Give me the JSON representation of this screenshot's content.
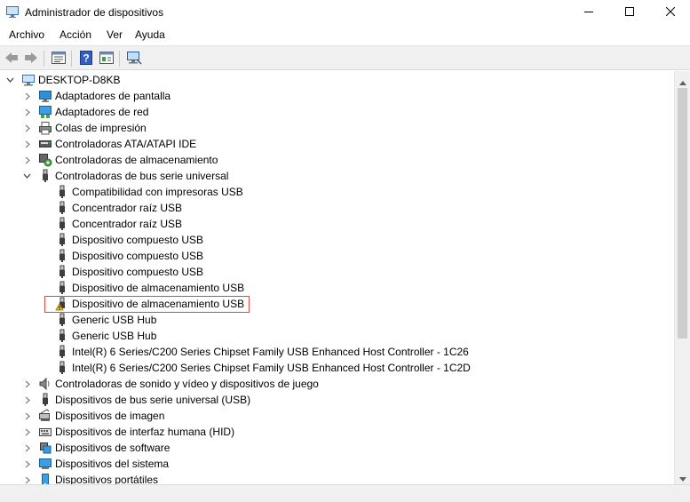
{
  "window": {
    "title": "Administrador de dispositivos",
    "icons": {
      "app": "device-manager-icon",
      "minimize": "minimize-icon",
      "maximize": "maximize-icon",
      "close": "close-icon"
    }
  },
  "menu": [
    "Archivo",
    "Acción",
    "Ver",
    "Ayuda"
  ],
  "toolbar": {
    "buttons": [
      "back-icon",
      "forward-icon",
      "properties-icon",
      "help-icon",
      "update-driver-icon",
      "monitor-scan-icon"
    ]
  },
  "tree": {
    "root": "DESKTOP-D8KB",
    "categories_before": [
      "Adaptadores de pantalla",
      "Adaptadores de red",
      "Colas de impresión",
      "Controladoras ATA/ATAPI IDE",
      "Controladoras de almacenamiento"
    ],
    "expanded": {
      "label": "Controladoras de bus serie universal",
      "children": [
        "Compatibilidad con impresoras USB",
        "Concentrador raíz USB",
        "Concentrador raíz USB",
        "Dispositivo compuesto USB",
        "Dispositivo compuesto USB",
        "Dispositivo compuesto USB",
        "Dispositivo de almacenamiento USB",
        "Dispositivo de almacenamiento USB",
        "Generic USB Hub",
        "Generic USB Hub",
        "Intel(R) 6 Series/C200 Series Chipset Family USB Enhanced Host Controller - 1C26",
        "Intel(R) 6 Series/C200 Series Chipset Family USB Enhanced Host Controller - 1C2D"
      ],
      "warning_child": "Dispositivo de almacenamiento USB"
    },
    "categories_after": [
      "Controladoras de sonido y vídeo y dispositivos de juego",
      "Dispositivos de bus serie universal (USB)",
      "Dispositivos de imagen",
      "Dispositivos de interfaz humana (HID)",
      "Dispositivos de software",
      "Dispositivos del sistema",
      "Dispositivos portátiles"
    ]
  },
  "colors": {
    "highlight_border": "#e0483e",
    "warning": "#f2c21b",
    "accent": "#2b78d4"
  }
}
